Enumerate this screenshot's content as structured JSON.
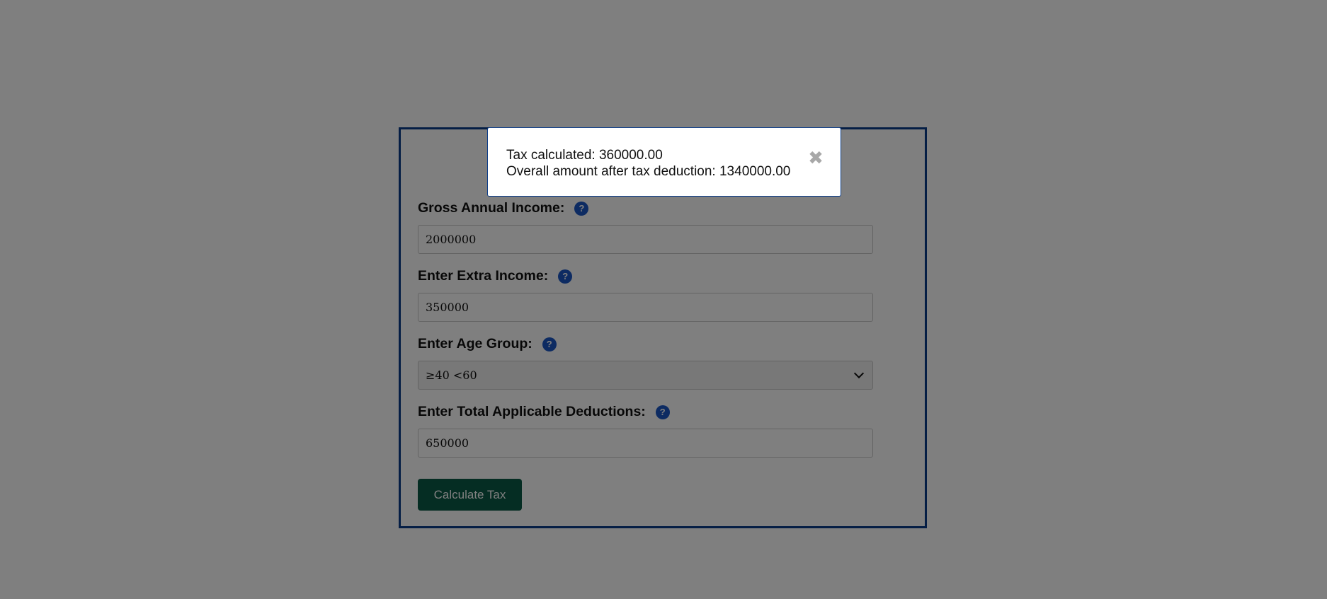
{
  "form": {
    "fields": [
      {
        "label": "Gross Annual Income:",
        "value": "2000000"
      },
      {
        "label": "Enter Extra Income:",
        "value": "350000"
      },
      {
        "label": "Enter Age Group:",
        "value": "≥40 <60"
      },
      {
        "label": "Enter Total Applicable Deductions:",
        "value": "650000"
      }
    ],
    "help_symbol": "?",
    "submit_label": "Calculate Tax"
  },
  "modal": {
    "line1": "Tax calculated: 360000.00",
    "line2": "Overall amount after tax deduction: 1340000.00",
    "close_symbol": "✖"
  },
  "colors": {
    "card_border": "#0b3d8a",
    "help_icon": "#1a56c4",
    "button": "#0a5a47",
    "overlay": "rgba(0,0,0,0.5)"
  },
  "icons": [
    "help-icon",
    "chevron-down-icon",
    "close-icon"
  ]
}
